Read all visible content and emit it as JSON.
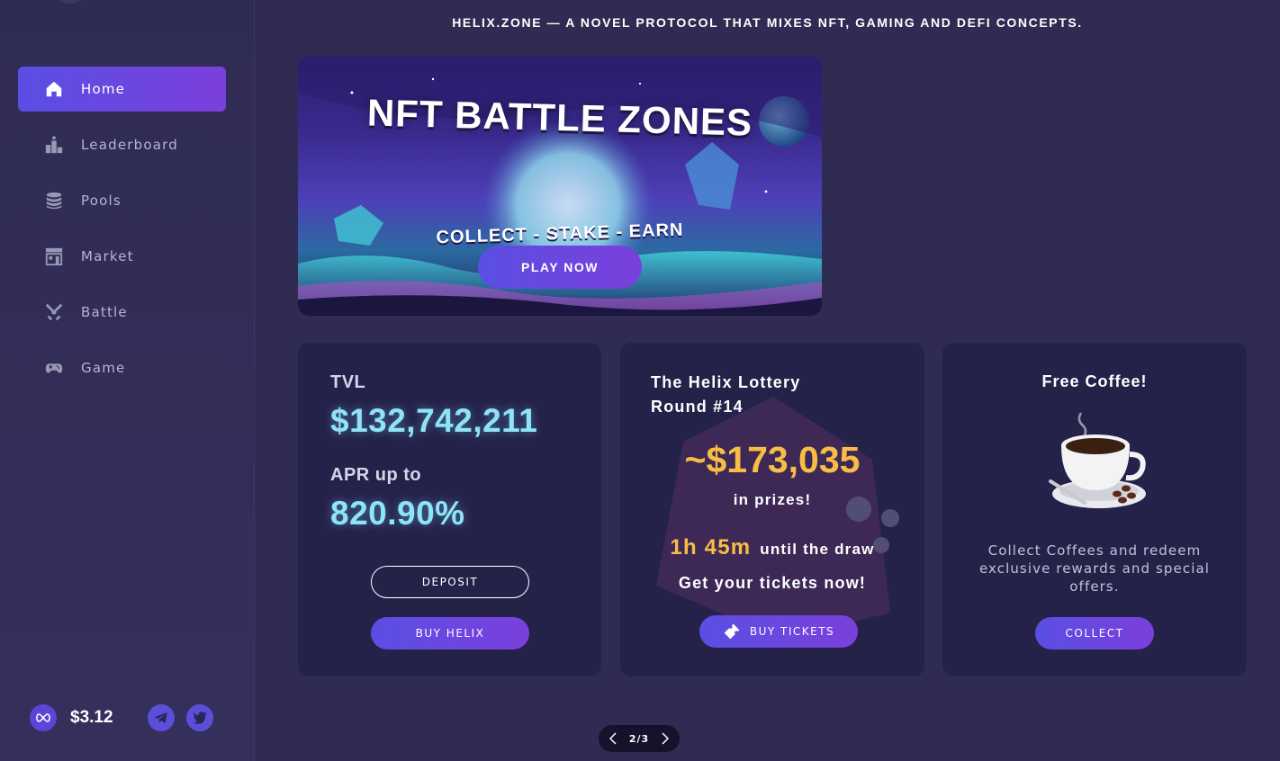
{
  "header": {
    "tagline": "HELIX.ZONE — A NOVEL PROTOCOL THAT MIXES NFT, GAMING AND DEFI CONCEPTS."
  },
  "sidebar": {
    "items": [
      {
        "label": "Home",
        "icon": "home-icon",
        "active": true
      },
      {
        "label": "Leaderboard",
        "icon": "leaderboard-icon",
        "active": false
      },
      {
        "label": "Pools",
        "icon": "coins-stack-icon",
        "active": false
      },
      {
        "label": "Market",
        "icon": "market-icon",
        "active": false
      },
      {
        "label": "Battle",
        "icon": "crossed-swords-icon",
        "active": false
      },
      {
        "label": "Game",
        "icon": "gamepad-icon",
        "active": false
      }
    ],
    "footer": {
      "token_price": "$3.12"
    }
  },
  "banner": {
    "title": "NFT BATTLE ZONES",
    "subtitle": "COLLECT - STAKE - EARN",
    "button": "PLAY NOW"
  },
  "tvl_card": {
    "tvl_label": "TVL",
    "tvl_value": "$132,742,211",
    "apr_label": "APR up to",
    "apr_value": "820.90%",
    "deposit_button": "DEPOSIT",
    "buy_button": "BUY HELIX"
  },
  "lottery_card": {
    "title_line1": "The Helix Lottery",
    "title_line2": "Round #14",
    "prize": "~$173,035",
    "prize_sub": "in prizes!",
    "countdown_time": "1h 45m",
    "countdown_text": "until the draw",
    "cta": "Get your tickets now!",
    "button": "BUY TICKETS"
  },
  "coffee_card": {
    "title": "Free Coffee!",
    "text": "Collect Coffees and redeem exclusive rewards and special offers.",
    "button": "COLLECT"
  },
  "pager": {
    "label": "2/3"
  },
  "colors": {
    "accent_start": "#5a4fe3",
    "accent_end": "#7b3fdc",
    "tvl_cyan": "#8ee3f7",
    "prize_gold": "#f7bd45",
    "card_bg": "#25224a",
    "page_bg": "#2f2b52"
  }
}
